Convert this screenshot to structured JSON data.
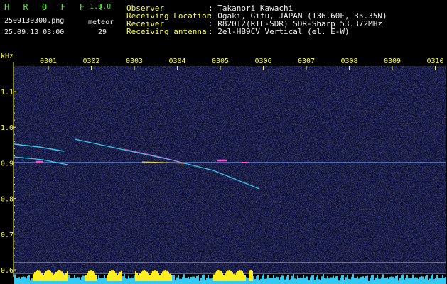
{
  "app": {
    "name": "H R O F F T",
    "version": "1.0.0"
  },
  "file": {
    "name": "2509130300.png",
    "datetime": "25.09.13 03:00"
  },
  "meteor": {
    "label": "meteor",
    "count": "29"
  },
  "info": {
    "labels": [
      "Observer",
      "Receiving Location",
      "Receiver",
      "Receiving antenna"
    ],
    "values": [
      ": Takanori Kawachi",
      ": Ogaki, Gifu, JAPAN (136.60E, 35.35N)",
      ": R820T2(RTL-SDR) SDR-Sharp 53.372MHz",
      ": 2el-HB9CV Vertical (el. E-W)"
    ]
  },
  "chart_data": {
    "type": "spectrogram",
    "y_unit_label": "kHz",
    "time_ticks": [
      "0301",
      "0302",
      "0303",
      "0304",
      "0305",
      "0306",
      "0307",
      "0308",
      "0309",
      "0310"
    ],
    "freq_ticks": [
      "1.1",
      "1.0",
      "0.9",
      "0.8",
      "0.7",
      "0.6"
    ],
    "carrier_khz": 0.9
  },
  "colors": {
    "background": "#000000",
    "title_green": "#39ff14",
    "label_yellow": "#ffff3c",
    "text_white": "#f0f0f0",
    "noise_blue": "#1a1f7a",
    "bottom_cyan": "#35c8f0",
    "bottom_yellow": "#ffee22"
  }
}
